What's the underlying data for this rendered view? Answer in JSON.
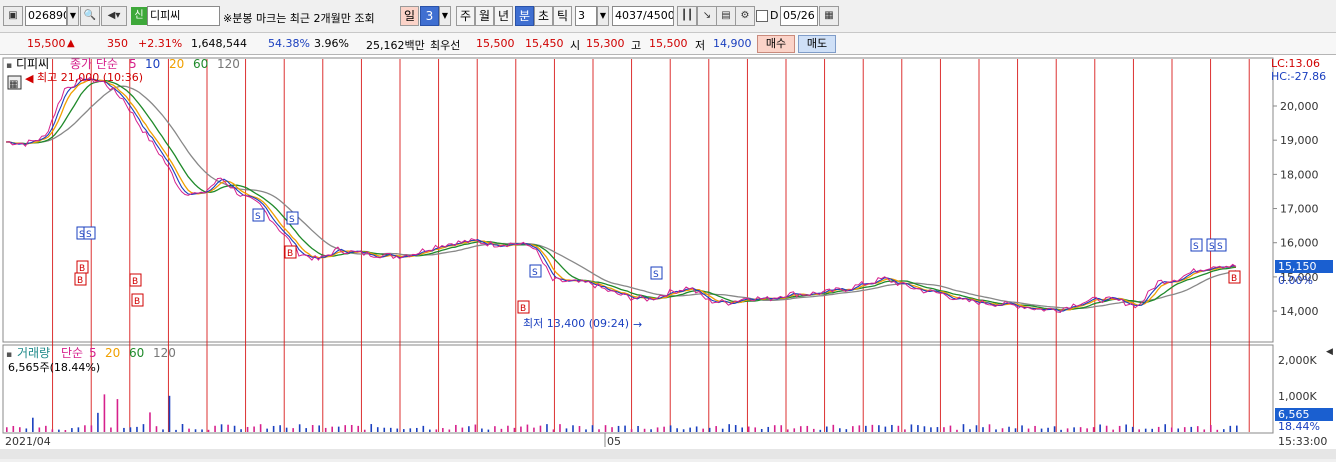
{
  "toolbar": {
    "stock_code": "026890",
    "credit_badge": "신",
    "stock_name": "디피씨",
    "notice": "※분봉 마크는 최근 2개월만 조회",
    "period_day": "일",
    "period_value": "3",
    "tabs": [
      "주",
      "월",
      "년",
      "분",
      "초",
      "틱"
    ],
    "selected_tab": "분",
    "tick_value": "3",
    "count_current": "4037",
    "count_total": "/4500",
    "checkbox_label": "D",
    "date_value": "05/26"
  },
  "quote": {
    "price": "15,500",
    "arrow": "▲",
    "change": "350",
    "change_pct": "+2.31%",
    "volume": "1,648,544",
    "vol_ratio": "54.38%",
    "turnover": "3.96%",
    "amount": "25,162백만",
    "bid_label": "최우선",
    "ask1": "15,500",
    "bid1": "15,450",
    "open_label": "시",
    "open": "15,300",
    "high_label": "고",
    "high": "15,500",
    "low_label": "저",
    "low": "14,900",
    "buy_label": "매수",
    "sell_label": "매도"
  },
  "price_panel": {
    "name": "디피씨",
    "ma_prefix": "종가 단순",
    "ma_periods": [
      "5",
      "10",
      "20",
      "60",
      "120"
    ],
    "ma_colors": [
      "#d6208c",
      "#1a3fbf",
      "#f0a000",
      "#1f8a2a",
      "#777777"
    ],
    "high_marker": "최고 21,000 (10:36)",
    "low_marker": "최저 13,400 (09:24)",
    "lc_label": "LC:13.06",
    "hc_label": "HC:-27.86",
    "current_price_tag": "15,150",
    "current_pct_tag": "0.00%",
    "y_ticks": [
      "20,000",
      "19,000",
      "18,000",
      "17,000",
      "16,000",
      "15,000",
      "14,000"
    ]
  },
  "volume_panel": {
    "label": "거래량",
    "ma_prefix": "단순",
    "ma_periods": [
      "5",
      "20",
      "60",
      "120"
    ],
    "ma_colors": [
      "#d6208c",
      "#f0a000",
      "#1f8a2a",
      "#777777"
    ],
    "last_volume": "6,565주(18.44%)",
    "y_ticks": [
      "2,000K",
      "1,000K"
    ],
    "vol_tag": "6,565",
    "vol_pct_tag": "18.44%"
  },
  "x_axis": {
    "labels": [
      "2021/04",
      "05"
    ],
    "time_label": "15:33:00"
  },
  "chart_data": {
    "type": "line",
    "title": "디피씨",
    "ylim": [
      13300,
      21200
    ],
    "series": [
      {
        "name": "종가",
        "values": [
          18950,
          18900,
          19100,
          20500,
          20800,
          20700,
          20200,
          19300,
          18500,
          17500,
          17400,
          17900,
          17400,
          17100,
          16400,
          15700,
          15500,
          15800,
          15700,
          15650,
          15600,
          15700,
          15900,
          16000,
          16050,
          15950,
          15980,
          15900,
          14900,
          14850,
          14800,
          14550,
          14400,
          14350,
          14550,
          14700,
          14300,
          14250,
          14400,
          14350,
          14500,
          14500,
          14550,
          14650,
          14800,
          14950,
          14750,
          14600,
          14500,
          14300,
          14250,
          14200,
          14150,
          14050,
          14050,
          14250,
          14350,
          14300,
          14150,
          14850,
          14950,
          15200,
          15350,
          15300
        ]
      }
    ]
  }
}
